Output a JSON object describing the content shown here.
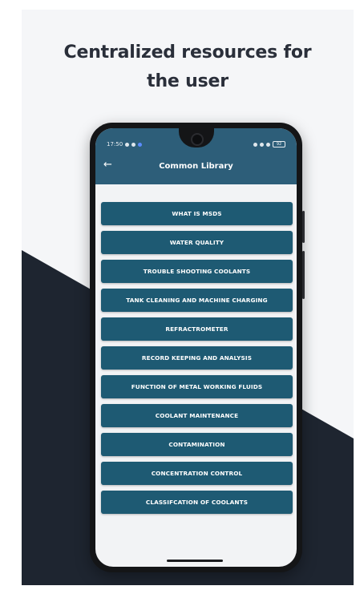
{
  "headline": {
    "line1": "Centralized resources for",
    "line2": "the user"
  },
  "status_bar": {
    "time": "17:50",
    "battery": "92"
  },
  "toolbar": {
    "back_icon": "arrow-left-icon",
    "title": "Common Library"
  },
  "library_items": [
    {
      "label": "WHAT IS MSDS"
    },
    {
      "label": "WATER QUALITY"
    },
    {
      "label": "TROUBLE SHOOTING COOLANTS"
    },
    {
      "label": "TANK CLEANING AND MACHINE CHARGING"
    },
    {
      "label": "REFRACTROMETER"
    },
    {
      "label": "RECORD KEEPING AND ANALYSIS"
    },
    {
      "label": "FUNCTION OF METAL WORKING FLUIDS"
    },
    {
      "label": "COOLANT MAINTENANCE"
    },
    {
      "label": "CONTAMINATION"
    },
    {
      "label": "CONCENTRATION CONTROL"
    },
    {
      "label": "CLASSIFCATION OF COOLANTS"
    }
  ],
  "colors": {
    "appbar": "#2d5e79",
    "item": "#1e5a73",
    "dark_background": "#1e2530"
  }
}
